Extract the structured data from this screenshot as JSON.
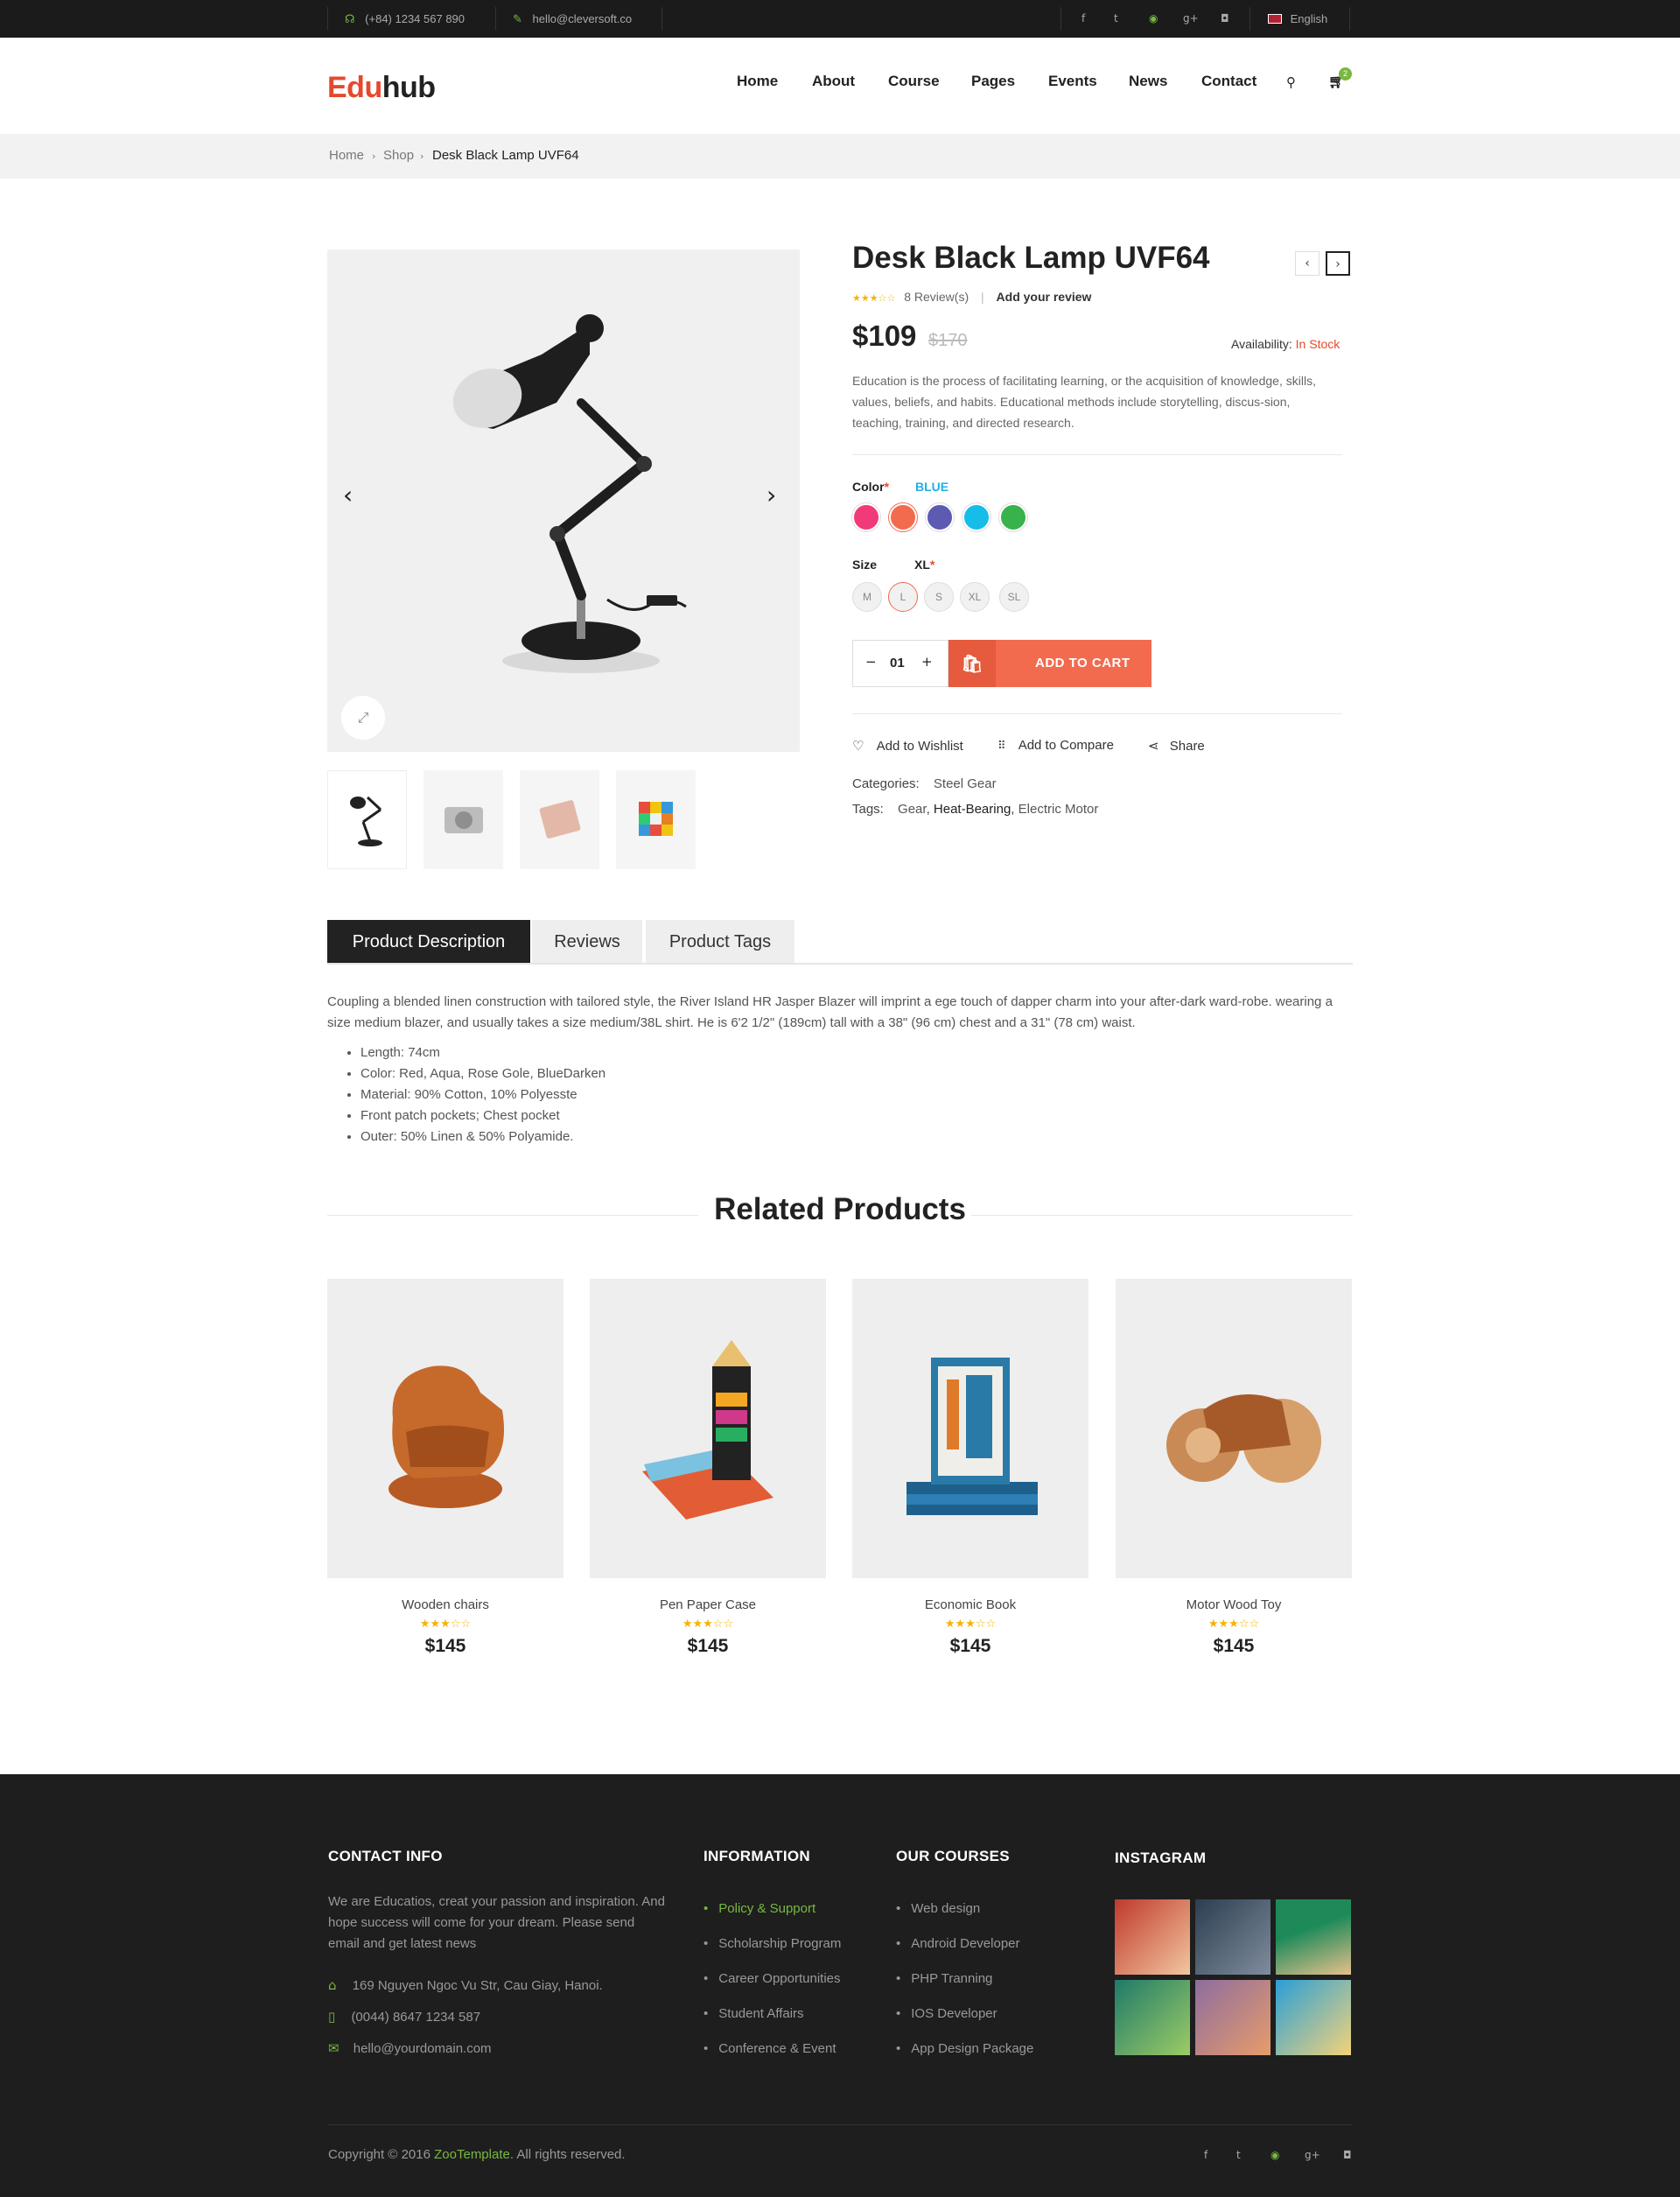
{
  "topbar": {
    "phone": "(+84) 1234 567 890",
    "email": "hello@cleversoft.co",
    "language": "English"
  },
  "header": {
    "logo_part1": "Edu",
    "logo_part2": "hub",
    "nav": [
      "Home",
      "About",
      "Course",
      "Pages",
      "Events",
      "News",
      "Contact"
    ],
    "cart_count": "2"
  },
  "breadcrumb": [
    "Home",
    "Shop",
    "Desk Black Lamp UVF64"
  ],
  "product": {
    "title": "Desk Black Lamp UVF64",
    "rating": 3,
    "reviews": "8 Review(s)",
    "add_review": "Add your review",
    "price": "$109",
    "old_price": "$170",
    "availability_label": "Availability:",
    "availability_value": "In Stock",
    "description": "Education is the process of facilitating learning, or the acquisition of knowledge, skills, values, beliefs, and habits. Educational methods include storytelling, discus-sion, teaching, training, and directed research.",
    "color_label": "Color",
    "color_selected": "BLUE",
    "colors": [
      "#f2397a",
      "#f26b4e",
      "#5c5ab1",
      "#16bde9",
      "#38b24a"
    ],
    "size_label": "Size",
    "size_selected": "XL",
    "sizes": [
      "M",
      "L",
      "S",
      "XL",
      "SL"
    ],
    "quantity": "01",
    "add_to_cart": "ADD TO CART",
    "wishlist": "Add to Wishlist",
    "compare": "Add to Compare",
    "share": "Share",
    "categories_label": "Categories:",
    "categories": "Steel Gear",
    "tags_label": "Tags:",
    "tags": [
      "Gear",
      "Heat-Bearing",
      "Electric Motor"
    ]
  },
  "tabs": {
    "items": [
      "Product Description",
      "Reviews",
      "Product Tags"
    ],
    "active": 0,
    "content": "Coupling a blended linen construction with tailored style, the River Island HR Jasper Blazer will imprint a ege touch of dapper charm into your after-dark ward-robe. wearing a size medium blazer, and usually takes a size medium/38L shirt. He is 6'2 1/2\" (189cm) tall with a 38\" (96 cm) chest and a 31\" (78 cm) waist.",
    "bullets": [
      "Length: 74cm",
      "Color: Red, Aqua, Rose Gole, BlueDarken",
      "Material: 90% Cotton, 10% Polyesste",
      "Front patch pockets; Chest pocket",
      "Outer: 50% Linen & 50% Polyamide."
    ]
  },
  "related": {
    "title": "Related Products",
    "items": [
      {
        "name": "Wooden chairs",
        "rating": 3,
        "price": "$145"
      },
      {
        "name": "Pen Paper Case",
        "rating": 3,
        "price": "$145"
      },
      {
        "name": "Economic Book",
        "rating": 3,
        "price": "$145"
      },
      {
        "name": "Motor Wood Toy",
        "rating": 3,
        "price": "$145"
      }
    ]
  },
  "footer": {
    "contact_title": "CONTACT INFO",
    "contact_text": "We are Educatios, creat your passion and inspiration. And hope success will come for your dream. Please send email and get latest news",
    "address": "169 Nguyen Ngoc Vu Str, Cau Giay, Hanoi.",
    "phone": "(0044) 8647 1234 587",
    "email": "hello@yourdomain.com",
    "info_title": "INFORMATION",
    "info_items": [
      "Policy & Support",
      "Scholarship Program",
      "Career Opportunities",
      "Student Affairs",
      "Conference & Event"
    ],
    "courses_title": "OUR COURSES",
    "courses_items": [
      "Web design",
      "Android Developer",
      "PHP Tranning",
      "IOS Developer",
      "App Design Package"
    ],
    "instagram_title": "INSTAGRAM",
    "copyright_prefix": "Copyright © 2016 ",
    "copyright_brand": "ZooTemplate",
    "copyright_suffix": ". All rights reserved."
  },
  "colors": {
    "accent": "#f26b4e",
    "brand_red": "#e5492d",
    "green": "#78b840",
    "star": "#f5b301"
  }
}
